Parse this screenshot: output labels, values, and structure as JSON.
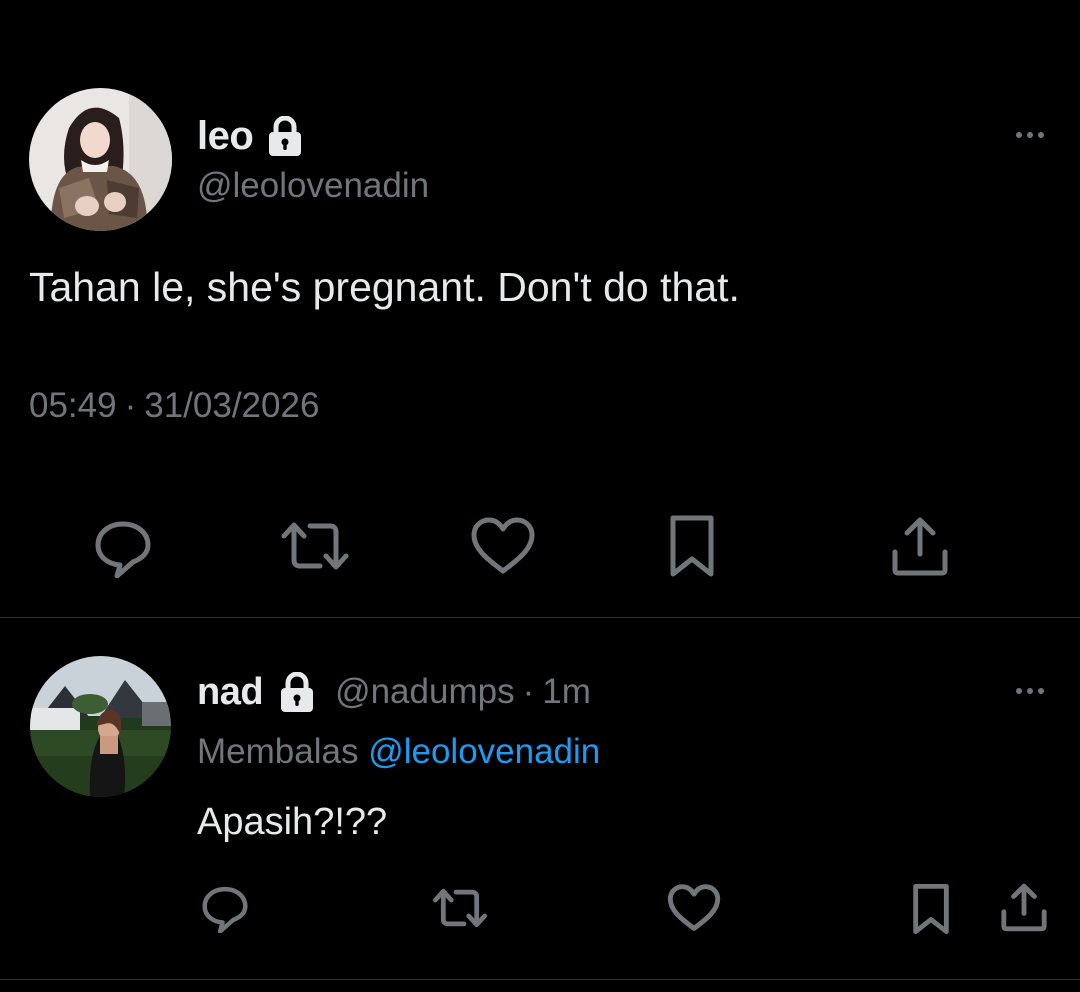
{
  "main_tweet": {
    "display_name": "leo",
    "handle": "@leolovenadin",
    "text": "Tahan le, she's pregnant. Don't do that.",
    "time": "05:49",
    "date": "31/03/2026",
    "separator": "·",
    "protected_icon": "lock-icon",
    "more_icon": "more-options-icon",
    "actions": [
      "reply-icon",
      "retweet-icon",
      "like-icon",
      "bookmark-icon",
      "share-icon"
    ]
  },
  "reply_tweet": {
    "display_name": "nad",
    "handle": "@nadumps",
    "separator": "·",
    "age": "1m",
    "replying_to_label": "Membalas",
    "replying_to_handle": "@leolovenadin",
    "text": "Apasih?!??",
    "protected_icon": "lock-icon",
    "more_icon": "more-options-icon",
    "actions": [
      "reply-icon",
      "retweet-icon",
      "like-icon",
      "bookmark-icon",
      "share-icon"
    ]
  },
  "colors": {
    "background": "#000000",
    "text_primary": "#e7e9ea",
    "text_secondary": "#71767b",
    "link": "#1d9bf0",
    "divider": "#2f3336",
    "icon": "#71767b"
  }
}
